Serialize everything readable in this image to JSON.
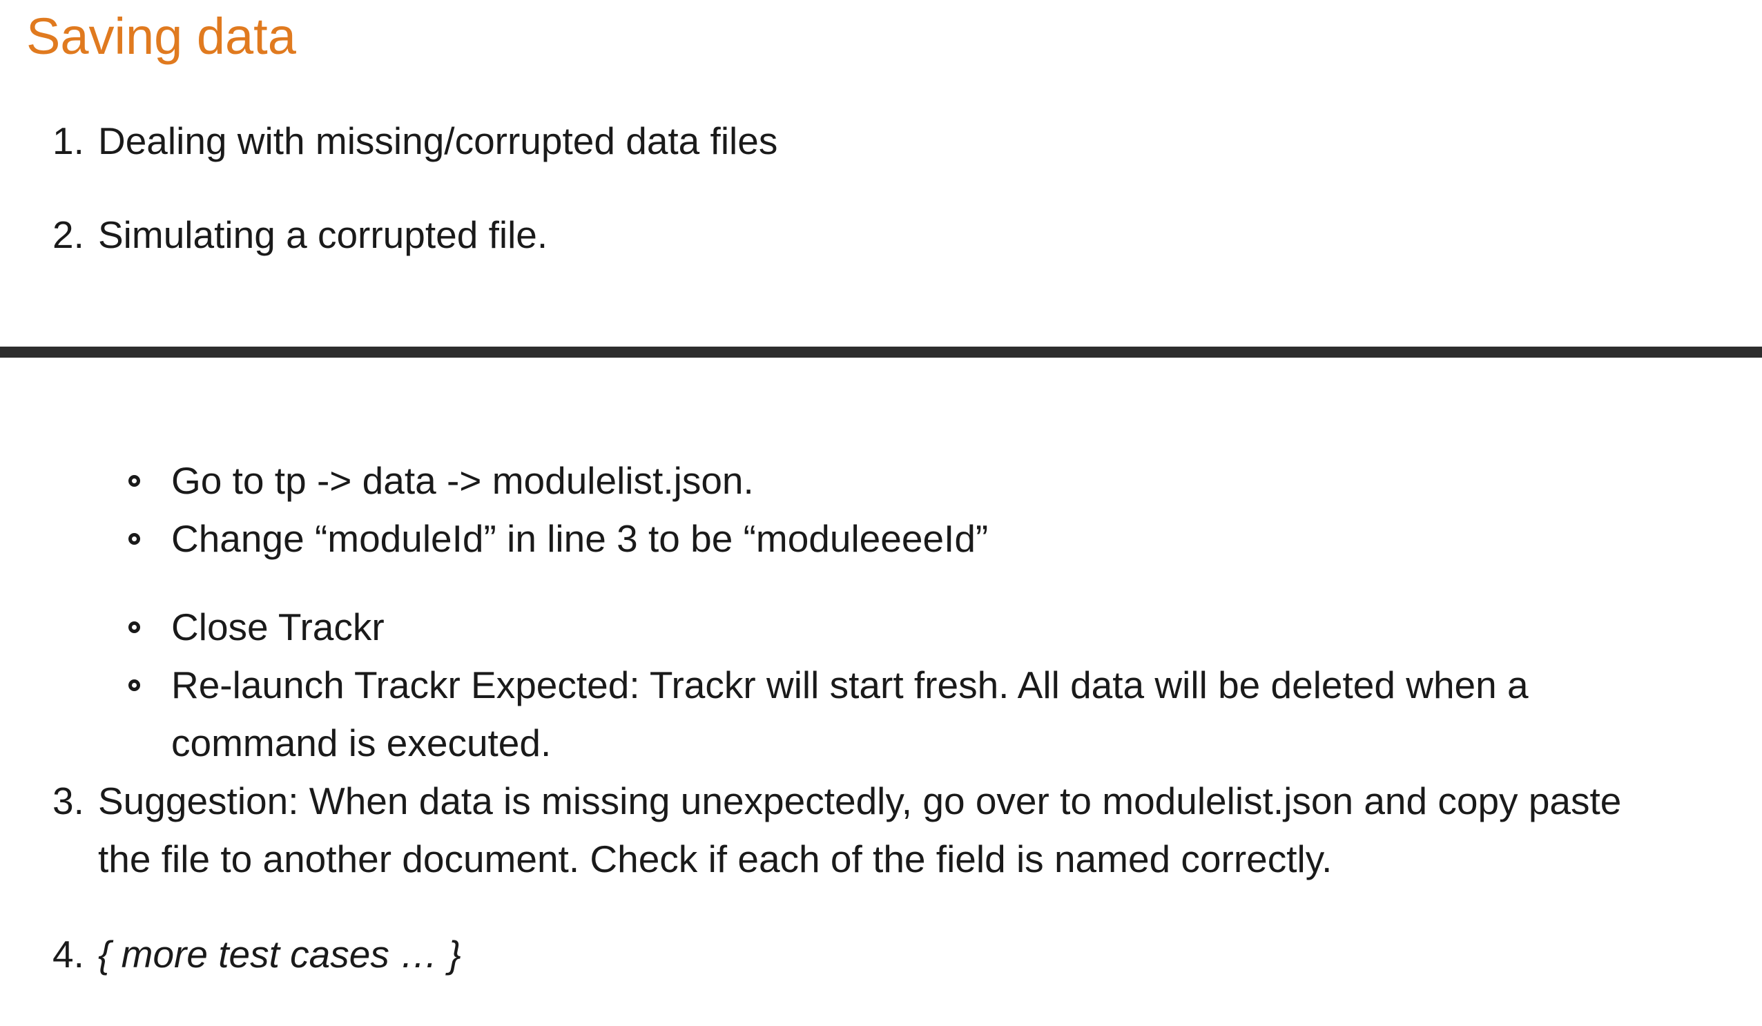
{
  "heading": "Saving data",
  "items": [
    {
      "number": "1.",
      "text": "Dealing with missing/corrupted data files"
    },
    {
      "number": "2.",
      "text": "Simulating a corrupted file."
    },
    {
      "number": "3.",
      "lines": [
        "Suggestion: When data is missing unexpectedly, go over to modulelist.json and copy paste",
        "the file to another document. Check if each of the field is named correctly."
      ]
    },
    {
      "number": "4.",
      "text": "{ more test cases … }"
    }
  ],
  "steps": [
    {
      "text": "Go to tp -> data -> modulelist.json."
    },
    {
      "text": "Change “moduleId” in line 3 to be “moduleeeeId”"
    },
    {
      "text": "Close Trackr"
    },
    {
      "lines": [
        "Re-launch Trackr Expected: Trackr will start fresh. All data will be deleted when a",
        "command is executed."
      ]
    }
  ],
  "colors": {
    "heading": "#e07a1f",
    "text": "#1a1a1a",
    "rule": "#2d2d2d"
  }
}
